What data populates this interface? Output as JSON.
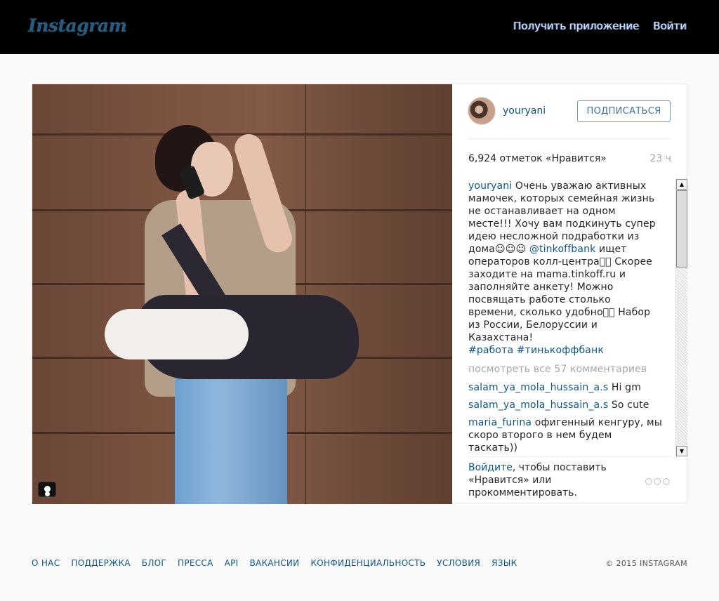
{
  "header": {
    "logo": "Instagram",
    "get_app": "Получить приложение",
    "login": "Войти"
  },
  "post": {
    "username": "youryani",
    "follow_button": "ПОДПИСАТЬСЯ",
    "likes": "6,924 отметок «Нравится»",
    "age": "23 ч",
    "caption": {
      "author": "youryani",
      "text_1": " Очень уважаю активных мамочек, которых семейная жизнь не останавливает на одном месте!!! Хочу вам подкинуть супер идею несложной подработки из дома☺☺☺ ",
      "mention": "@tinkoffbank",
      "text_2": " ищет операторов колл-центра⃞⃞ Скорее заходите на mama.tinkoff.ru и заполняйте анкету! Можно посвящать работе столько времени, сколько удобно⃞⃞ Набор из России, Белоруссии и Казахстана!",
      "hashtag_1": "#работа",
      "hashtag_2": "#тинькоффбанк"
    },
    "view_all": "посмотреть все 57 комментариев",
    "comments": [
      {
        "author": "salam_ya_mola_hussain_a.s",
        "text": " Hi gm"
      },
      {
        "author": "salam_ya_mola_hussain_a.s",
        "text": " So cute"
      },
      {
        "author": "maria_furina",
        "text": " офигенный кенгуру, мы скоро второго в нем будем таскать))"
      }
    ],
    "login_link": "Войдите",
    "login_text": ", чтобы поставить «Нравится» или прокомментировать.",
    "more": "○○○"
  },
  "footer": {
    "links": [
      "О НАС",
      "ПОДДЕРЖКА",
      "БЛОГ",
      "ПРЕССА",
      "API",
      "ВАКАНСИИ",
      "КОНФИДЕНЦИАЛЬНОСТЬ",
      "УСЛОВИЯ",
      "ЯЗЫК"
    ],
    "copyright": "© 2015 INSTAGRAM"
  },
  "scrollbar": {
    "up": "▲",
    "down": "▼"
  },
  "colors": {
    "link": "#125688",
    "header_bg": "#000000",
    "page_bg": "#fafafa"
  }
}
